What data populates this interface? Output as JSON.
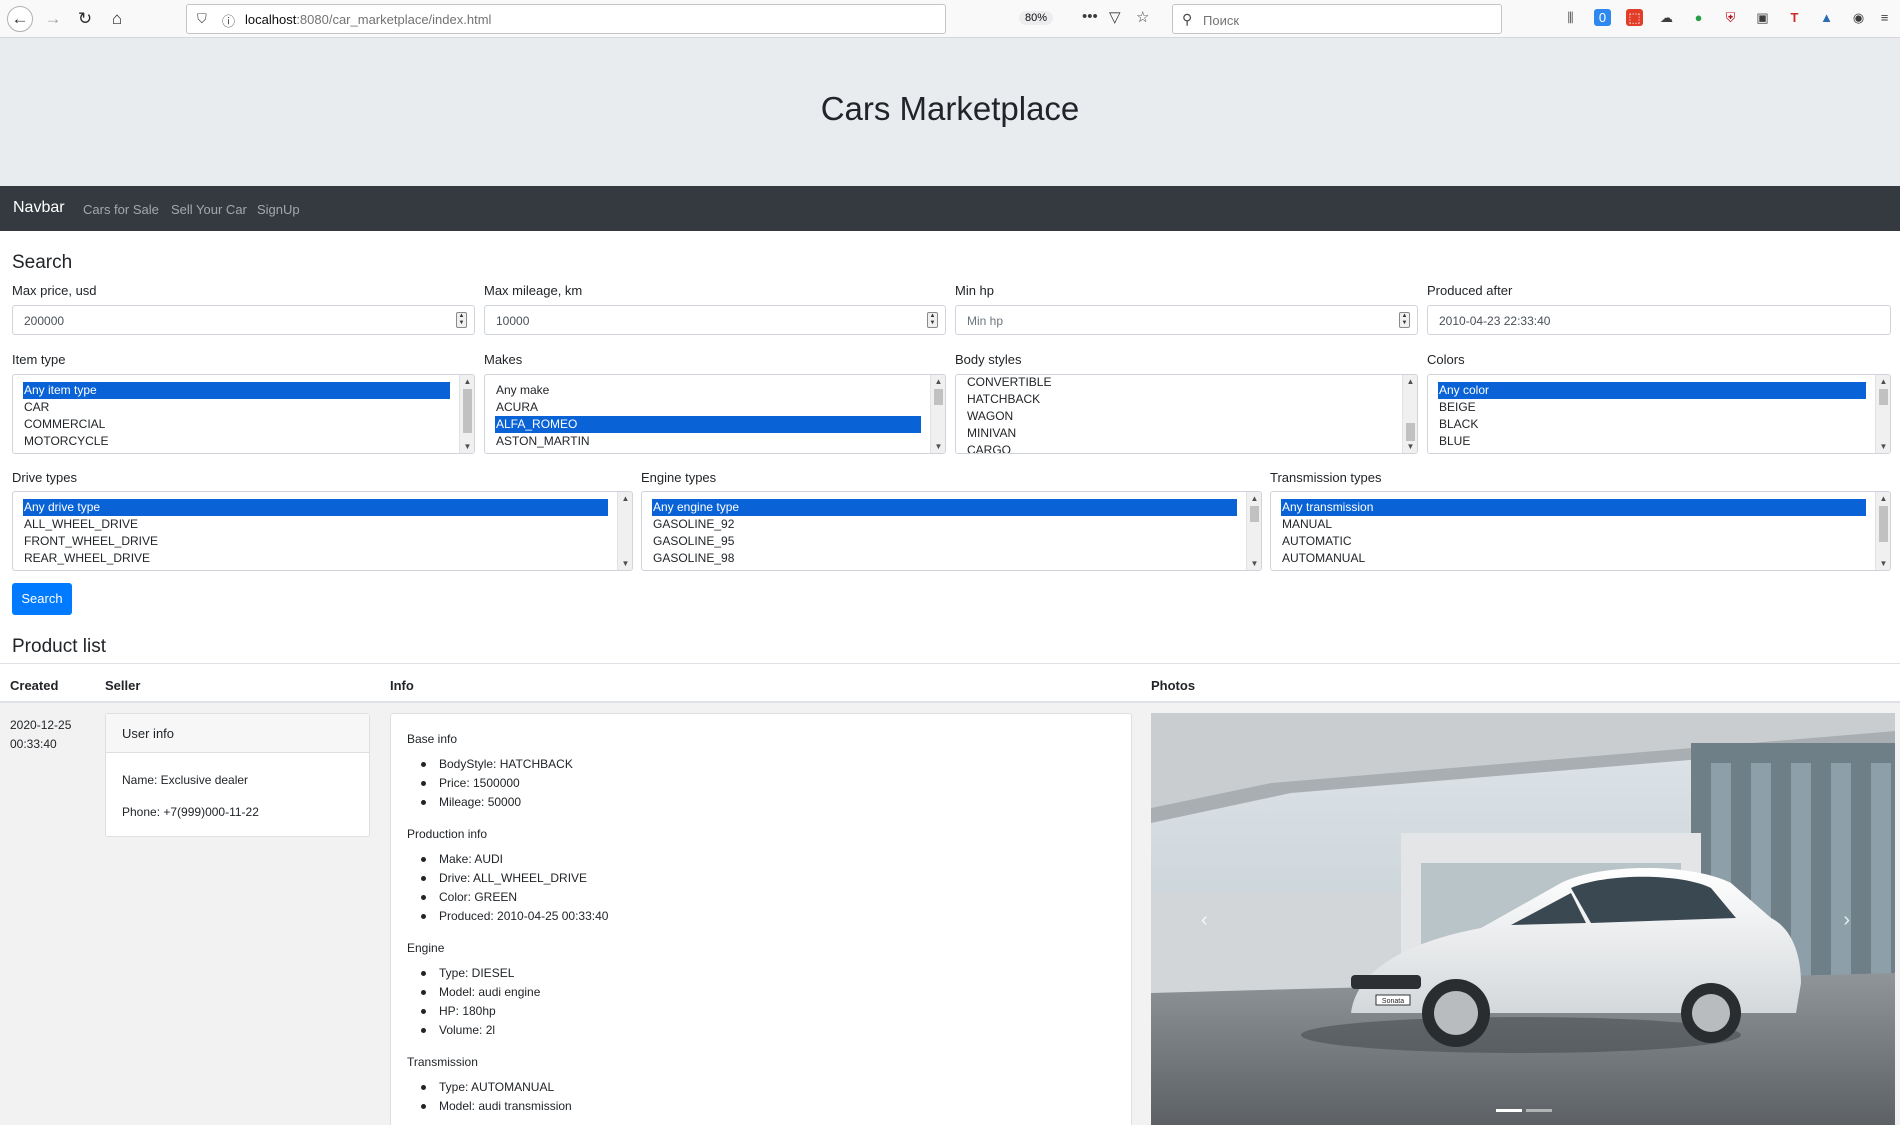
{
  "browser": {
    "url_host": "localhost",
    "url_rest": ":8080/car_marketplace/index.html",
    "zoom": "80%",
    "search_placeholder": "Поиск"
  },
  "page": {
    "title": "Cars Marketplace"
  },
  "navbar": {
    "brand": "Navbar",
    "links": [
      "Cars for Sale",
      "Sell Your Car",
      "SignUp"
    ]
  },
  "search": {
    "heading": "Search",
    "max_price": {
      "label": "Max price, usd",
      "value": "200000"
    },
    "max_mileage": {
      "label": "Max mileage, km",
      "value": "10000"
    },
    "min_hp": {
      "label": "Min hp",
      "placeholder": "Min hp"
    },
    "produced_after": {
      "label": "Produced after",
      "value": "2010-04-23 22:33:40"
    },
    "item_type": {
      "label": "Item type",
      "options": [
        "Any item type",
        "CAR",
        "COMMERCIAL",
        "MOTORCYCLE"
      ],
      "selected": 0,
      "thumb_fraction": 0.85,
      "thumb_offset": 0
    },
    "makes": {
      "label": "Makes",
      "options": [
        "Any make",
        "ACURA",
        "ALFA_ROMEO",
        "ASTON_MARTIN"
      ],
      "selected": 2,
      "thumb_fraction": 0.3,
      "thumb_offset": 0
    },
    "body_styles": {
      "label": "Body styles",
      "options": [
        "CONVERTIBLE",
        "HATCHBACK",
        "WAGON",
        "MINIVAN",
        "CARGO"
      ],
      "selected": -1,
      "thumb_fraction": 0.35,
      "thumb_offset": 1
    },
    "colors": {
      "label": "Colors",
      "options": [
        "Any color",
        "BEIGE",
        "BLACK",
        "BLUE"
      ],
      "selected": 0,
      "thumb_fraction": 0.3,
      "thumb_offset": 0
    },
    "drive_types": {
      "label": "Drive types",
      "options": [
        "Any drive type",
        "ALL_WHEEL_DRIVE",
        "FRONT_WHEEL_DRIVE",
        "REAR_WHEEL_DRIVE"
      ],
      "selected": 0,
      "thumb_fraction": 0,
      "thumb_offset": 0
    },
    "engine_types": {
      "label": "Engine types",
      "options": [
        "Any engine type",
        "GASOLINE_92",
        "GASOLINE_95",
        "GASOLINE_98"
      ],
      "selected": 0,
      "thumb_fraction": 0.3,
      "thumb_offset": 0
    },
    "transmission_types": {
      "label": "Transmission types",
      "options": [
        "Any transmission",
        "MANUAL",
        "AUTOMATIC",
        "AUTOMANUAL"
      ],
      "selected": 0,
      "thumb_fraction": 0.7,
      "thumb_offset": 0
    },
    "button": "Search"
  },
  "products": {
    "heading": "Product list",
    "columns": [
      "Created",
      "Seller",
      "Info",
      "Photos"
    ],
    "row": {
      "created_date": "2020-12-25",
      "created_time": "00:33:40",
      "seller": {
        "header": "User info",
        "name": "Name: Exclusive dealer",
        "phone": "Phone: +7(999)000-11-22"
      },
      "info": {
        "base_title": "Base info",
        "base": [
          "BodyStyle: HATCHBACK",
          "Price: 1500000",
          "Mileage: 50000"
        ],
        "production_title": "Production info",
        "production": [
          "Make: AUDI",
          "Drive: ALL_WHEEL_DRIVE",
          "Color: GREEN",
          "Produced: 2010-04-25 00:33:40"
        ],
        "engine_title": "Engine",
        "engine": [
          "Type: DIESEL",
          "Model: audi engine",
          "HP: 180hp",
          "Volume: 2l"
        ],
        "transmission_title": "Transmission",
        "transmission": [
          "Type: AUTOMANUAL",
          "Model: audi transmission"
        ]
      },
      "photo_badge": "Sonata"
    }
  },
  "colors": {
    "primary": "#007bff",
    "navbar": "#343a40",
    "jumbotron": "#e9ecef",
    "selection": "#0a63d6"
  }
}
